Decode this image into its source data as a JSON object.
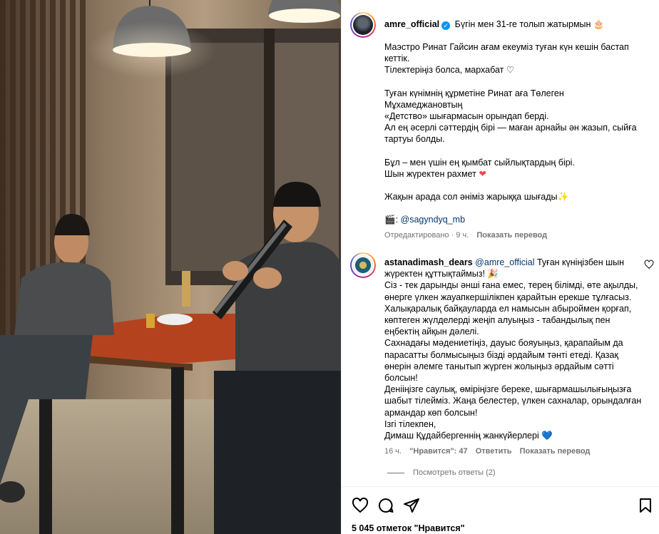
{
  "post": {
    "username": "amre_official",
    "headline": "Бүгін мен 31-ге толып жатырмын 🎂",
    "caption_lines": [
      "Маэстро Ринат Гайсин ағам екеуміз туған күн кешін бастап",
      "кеттік.",
      "Тілектеріңіз болса, мархабат ♡"
    ],
    "caption_lines_2": [
      "Туған күнімнің құрметіне Ринат аға Төлеген",
      "Мұхамеджановтың",
      "«Детство» шығармасын орындап берді.",
      "Ал ең әсерлі сәттердің бірі — маған арнайы ән жазып, сыйға",
      "тартуы болды."
    ],
    "caption_line_3a": "Бұл – мен үшін ең қымбат сыйлықтардың бірі.",
    "caption_line_3b": "Шын жүректен рахмет",
    "heart_red": "❤",
    "caption_line_4": "Жақын арада сол әніміз жарыққа шығады✨",
    "credit_icon": "🎬:",
    "credit_mention": "@sagyndyq_mb",
    "meta_edited": "Отредактировано · 9 ч.",
    "meta_translate": "Показать перевод"
  },
  "comment": {
    "username": "astanadimash_dears",
    "mention": "@amre_official",
    "lines": [
      "Туған күніңізбен шын",
      "жүректен құттықтаймыз! 🎉",
      "Сіз - тек дарынды әнші ғана емес, терең білімді, өте ақылды,",
      "өнерге үлкен жауапкершілікпен қарайтын ерекше тұлғасыз.",
      "Халықаралық байқауларда ел намысын абыроймен қорғап,",
      "көптеген жүлделерді жеңіп алуыңыз - табандылық пен",
      "еңбектің айқын дәлелі.",
      "Сахнадағы мәдениетіңіз, дауыс бояуыңыз, қарапайым да",
      "парасатты болмысыңыз бізді әрдайым тәнті етеді. Қазақ",
      "өнерін әлемге танытып жүрген жолыңыз әрдайым сәтті",
      "болсын!",
      "Денііңізге саулық, өміріңізге береке, шығармашылығыңызға",
      "шабыт тілейміз. Жаңа белестер, үлкен сахналар, орындалған",
      "армандар көп болсын!",
      "Ізгі тілекпен,",
      "Димаш Құдайбергеннің жанкүйерлері"
    ],
    "heart_blue": "💙",
    "time": "16 ч.",
    "likes": "\"Нравится\": 47",
    "reply": "Ответить",
    "translate": "Показать перевод",
    "view_replies": "Посмотреть ответы (2)"
  },
  "footer": {
    "likes_text": "5 045 отметок \"Нравится\""
  },
  "icons": [
    "verified-icon",
    "heart-icon",
    "comment-icon",
    "share-icon",
    "bookmark-icon"
  ],
  "colors": {
    "link": "#00376b",
    "meta": "#737373",
    "verified": "#0095f6",
    "heart": "#ed4956"
  }
}
